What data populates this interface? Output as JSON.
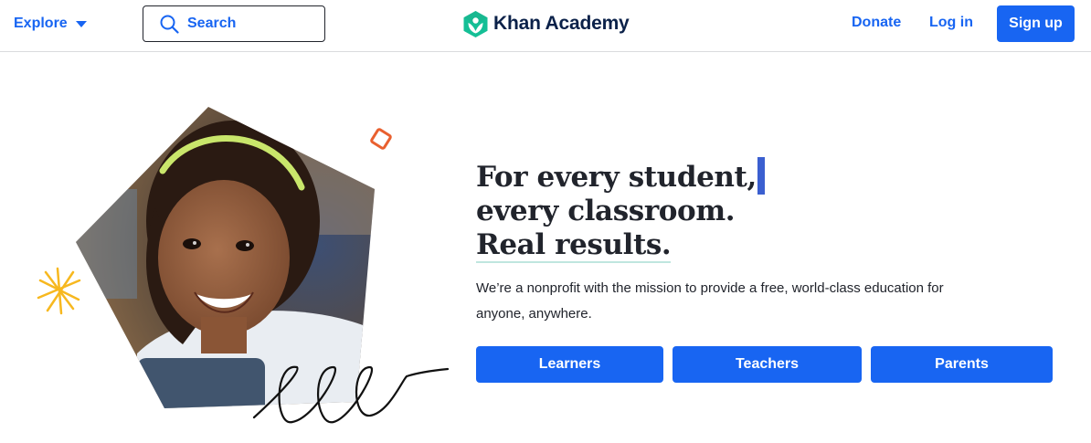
{
  "header": {
    "explore_label": "Explore",
    "search_placeholder": "Search",
    "brand_name": "Khan Academy",
    "donate_label": "Donate",
    "login_label": "Log in",
    "signup_label": "Sign up"
  },
  "hero": {
    "headline_line1": "For every student,",
    "headline_line2": "every classroom.",
    "headline_line3": "Real results.",
    "description": "We’re a nonprofit with the mission to provide a free, world-class education for anyone, anywhere.",
    "buttons": [
      {
        "label": "Learners"
      },
      {
        "label": "Teachers"
      },
      {
        "label": "Parents"
      }
    ]
  },
  "colors": {
    "accent": "#1865f2",
    "brand_green": "#14bf96",
    "brand_navy": "#0b2149",
    "text": "#21242c"
  },
  "icons": {
    "explore_caret": "caret-down-icon",
    "search": "search-icon",
    "logo": "khan-academy-logo-icon"
  }
}
